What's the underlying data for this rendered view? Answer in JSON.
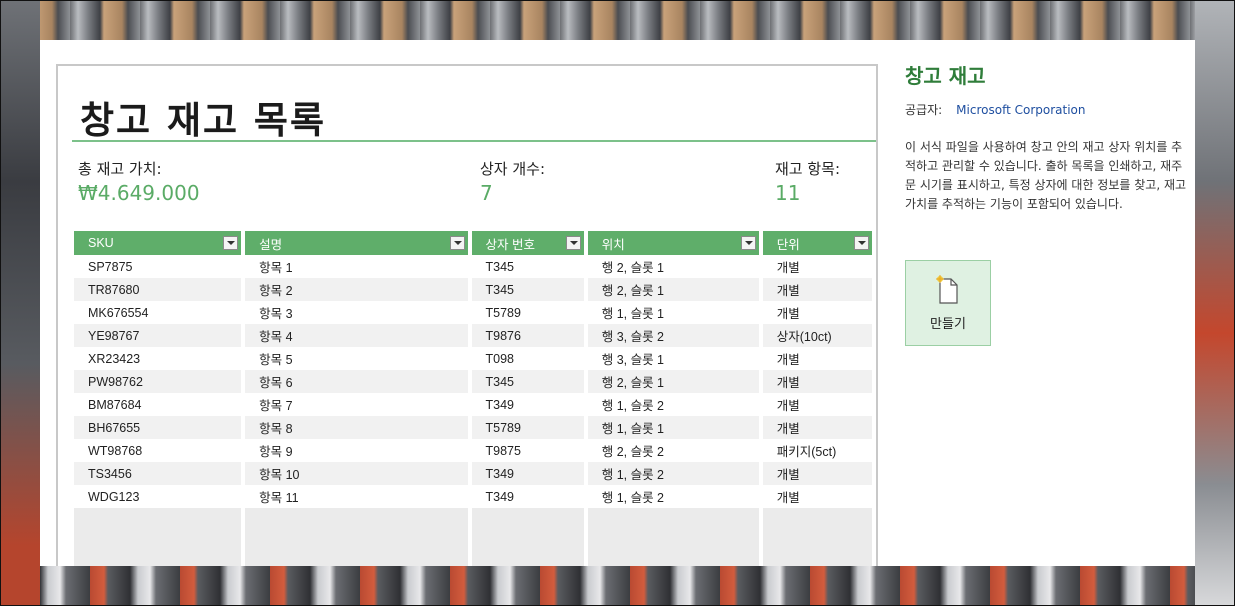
{
  "sheet": {
    "title": "창고 재고 목록",
    "stats": [
      {
        "label": "총 재고 가치:",
        "value": "₩4.649.000"
      },
      {
        "label": "상자 개수:",
        "value": "7"
      },
      {
        "label": "재고 항목:",
        "value": "11"
      }
    ],
    "columns": [
      "SKU",
      "설명",
      "상자 번호",
      "위치",
      "단위"
    ],
    "rows": [
      [
        "SP7875",
        "항목 1",
        "T345",
        "행 2, 슬롯 1",
        "개별"
      ],
      [
        "TR87680",
        "항목 2",
        "T345",
        "행 2, 슬롯 1",
        "개별"
      ],
      [
        "MK676554",
        "항목 3",
        "T5789",
        "행 1, 슬롯 1",
        "개별"
      ],
      [
        "YE98767",
        "항목 4",
        "T9876",
        "행 3, 슬롯 2",
        "상자(10ct)"
      ],
      [
        "XR23423",
        "항목 5",
        "T098",
        "행 3, 슬롯 1",
        "개별"
      ],
      [
        "PW98762",
        "항목 6",
        "T345",
        "행 2, 슬롯 1",
        "개별"
      ],
      [
        "BM87684",
        "항목 7",
        "T349",
        "행 1, 슬롯 2",
        "개별"
      ],
      [
        "BH67655",
        "항목 8",
        "T5789",
        "행 1, 슬롯 1",
        "개별"
      ],
      [
        "WT98768",
        "항목 9",
        "T9875",
        "행 2, 슬롯 2",
        "패키지(5ct)"
      ],
      [
        "TS3456",
        "항목 10",
        "T349",
        "행 1, 슬롯 2",
        "개별"
      ],
      [
        "WDG123",
        "항목 11",
        "T349",
        "행 1, 슬롯 2",
        "개별"
      ]
    ]
  },
  "info": {
    "title": "창고 재고",
    "vendor_label": "공급자:",
    "vendor": "Microsoft Corporation",
    "description": "이 서식 파일을 사용하여 창고 안의 재고 상자 위치를 추적하고 관리할 수 있습니다. 출하 목록을 인쇄하고, 재주문 시기를 표시하고, 특정 상자에 대한 정보를 찾고, 재고 가치를 추적하는 기능이 포함되어 있습니다.",
    "create_label": "만들기",
    "create_icon": "new-document-icon"
  },
  "colors": {
    "accent_green": "#5fae6a",
    "title_green": "#2f7d3a",
    "link_blue": "#1f4fa0"
  }
}
